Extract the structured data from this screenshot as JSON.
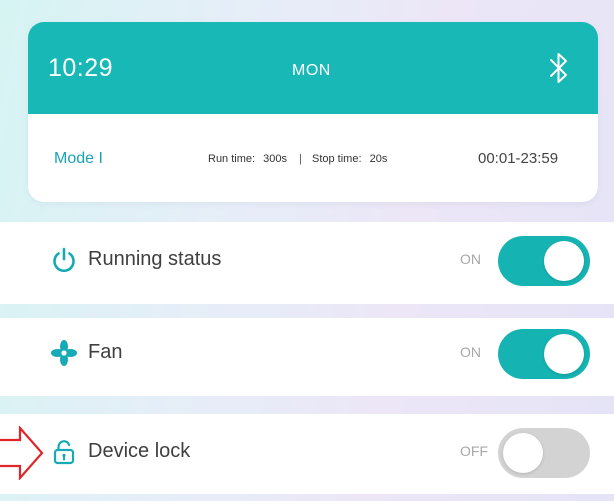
{
  "header": {
    "time": "10:29",
    "weekday": "MON",
    "bluetooth_icon": "bluetooth-icon",
    "mode": "Mode I",
    "run_time_label": "Run time:",
    "run_time_value": "300s",
    "separator": "|",
    "stop_time_label": "Stop time:",
    "stop_time_value": "20s",
    "time_range": "00:01-23:59"
  },
  "settings": [
    {
      "icon": "power-icon",
      "label": "Running status",
      "state": "ON",
      "enabled": true
    },
    {
      "icon": "fan-icon",
      "label": "Fan",
      "state": "ON",
      "enabled": true
    },
    {
      "icon": "unlock-icon",
      "label": "Device lock",
      "state": "OFF",
      "enabled": false
    }
  ],
  "colors": {
    "accent": "#18b8b6",
    "toggle_off": "#d3d3d3",
    "mode_text": "#1aa3b8",
    "annotation_arrow": "#e0262b"
  }
}
